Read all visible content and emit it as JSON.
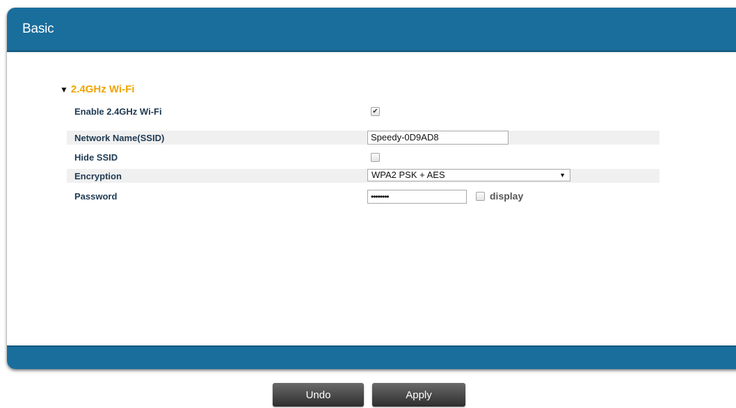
{
  "panel": {
    "title": "Basic"
  },
  "section": {
    "expand_glyph": "▼",
    "title": "2.4GHz Wi-Fi"
  },
  "fields": {
    "enable": {
      "label": "Enable 2.4GHz Wi-Fi",
      "checked": true,
      "glyph": "✔"
    },
    "ssid": {
      "label": "Network Name(SSID)",
      "value": "Speedy-0D9AD8"
    },
    "hide_ssid": {
      "label": "Hide SSID",
      "checked": false
    },
    "encryption": {
      "label": "Encryption",
      "selected": "WPA2 PSK + AES",
      "caret": "▼"
    },
    "password": {
      "label": "Password",
      "value": "••••••••",
      "display_label": "display",
      "display_checked": false
    }
  },
  "buttons": {
    "undo": "Undo",
    "apply": "Apply"
  },
  "colors": {
    "header": "#1a6e9c",
    "section_title": "#f0a400",
    "label": "#1f3a52"
  }
}
